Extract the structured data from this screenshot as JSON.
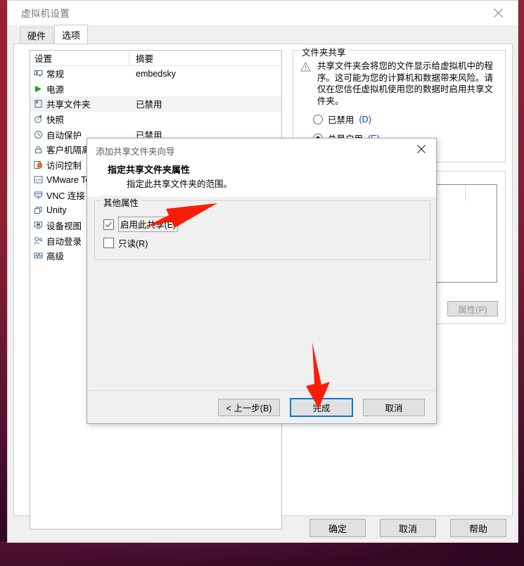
{
  "window": {
    "title": "虚拟机设置",
    "close_icon": "close-icon"
  },
  "tabs": [
    {
      "label": "硬件",
      "active": false
    },
    {
      "label": "选项",
      "active": true
    }
  ],
  "settings_table": {
    "columns": [
      "设置",
      "摘要"
    ],
    "rows": [
      {
        "icon": "monitor-icon",
        "label": "常规",
        "summary": "embedsky",
        "selected": false
      },
      {
        "icon": "play-icon",
        "label": "电源",
        "summary": "",
        "selected": false
      },
      {
        "icon": "shared-folder-icon",
        "label": "共享文件夹",
        "summary": "已禁用",
        "selected": true
      },
      {
        "icon": "snapshot-icon",
        "label": "快照",
        "summary": "",
        "selected": false
      },
      {
        "icon": "autoprotect-icon",
        "label": "自动保护",
        "summary": "已禁用",
        "selected": false
      },
      {
        "icon": "lock-icon",
        "label": "客户机隔离",
        "summary": "",
        "selected": false
      },
      {
        "icon": "access-control-icon",
        "label": "访问控制",
        "summary": "",
        "selected": false
      },
      {
        "icon": "vmware-tools-icon",
        "label": "VMware Tools",
        "summary": "",
        "selected": false
      },
      {
        "icon": "vnc-icon",
        "label": "VNC 连接",
        "summary": "",
        "selected": false
      },
      {
        "icon": "unity-icon",
        "label": "Unity",
        "summary": "",
        "selected": false
      },
      {
        "icon": "device-view-icon",
        "label": "设备视图",
        "summary": "",
        "selected": false
      },
      {
        "icon": "autologon-icon",
        "label": "自动登录",
        "summary": "",
        "selected": false
      },
      {
        "icon": "advanced-icon",
        "label": "高级",
        "summary": "",
        "selected": false
      }
    ]
  },
  "folder_sharing": {
    "legend": "文件夹共享",
    "warning_icon": "warning-icon",
    "warning_text": "共享文件夹会将您的文件显示给虚拟机中的程序。这可能为您的计算机和数据带来风险。请仅在您信任虚拟机使用您的数据时启用共享文件夹。",
    "options": [
      {
        "label": "已禁用",
        "accel": "(D)",
        "checked": false
      },
      {
        "label": "总是启用",
        "accel": "(E)",
        "checked": true
      },
      {
        "label": "",
        "accel": ")",
        "checked": false
      }
    ],
    "properties_button": "属性(P)"
  },
  "footer_buttons": [
    {
      "label": "确定"
    },
    {
      "label": "取消"
    },
    {
      "label": "帮助"
    }
  ],
  "dialog": {
    "title": "添加共享文件夹向导",
    "close_icon": "close-icon",
    "heading": "指定共享文件夹属性",
    "subheading": "指定此共享文件夹的范围。",
    "group_legend": "其他属性",
    "checkboxes": [
      {
        "label": "启用此共享(E)",
        "checked": true,
        "focused": true
      },
      {
        "label": "只读(R)",
        "checked": false,
        "focused": false
      }
    ],
    "buttons": [
      {
        "label": "< 上一步(B)",
        "default": false
      },
      {
        "label": "完成",
        "default": true
      },
      {
        "label": "取消",
        "default": false
      }
    ]
  },
  "annotations": {
    "arrow_color": "#fb1d07",
    "arrow_1_target": "启用此共享(E) 复选框",
    "arrow_2_target": "完成 按钮"
  }
}
